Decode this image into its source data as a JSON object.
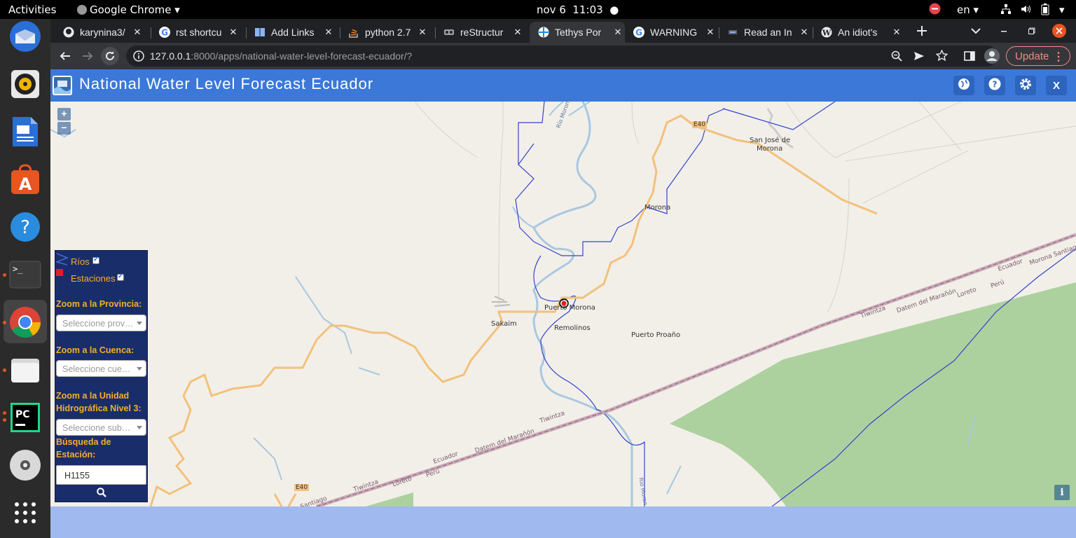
{
  "system_bar": {
    "activities": "Activities",
    "app_name": "Google Chrome",
    "date": "nov 6",
    "time": "11:03",
    "lang": "en"
  },
  "dock": {
    "items": [
      {
        "name": "thunderbird-icon"
      },
      {
        "name": "rhythmbox-icon"
      },
      {
        "name": "libreoffice-writer-icon"
      },
      {
        "name": "ubuntu-software-icon"
      },
      {
        "name": "help-icon"
      },
      {
        "name": "terminal-icon"
      },
      {
        "name": "chrome-icon"
      },
      {
        "name": "files-icon"
      },
      {
        "name": "pycharm-icon"
      },
      {
        "name": "dvd-icon"
      },
      {
        "name": "show-apps-icon"
      }
    ]
  },
  "tabs": [
    {
      "label": "karynina3/",
      "icon": "github-icon"
    },
    {
      "label": "rst shortcu",
      "icon": "google-icon"
    },
    {
      "label": "Add Links",
      "icon": "book-icon"
    },
    {
      "label": "python 2.7",
      "icon": "stackoverflow-icon"
    },
    {
      "label": "reStructur",
      "icon": "doc-icon"
    },
    {
      "label": "Tethys Por",
      "icon": "tethys-icon",
      "active": true
    },
    {
      "label": "WARNING",
      "icon": "google-icon"
    },
    {
      "label": "Read an In",
      "icon": "site-icon"
    },
    {
      "label": "An idiot's",
      "icon": "wordpress-icon"
    }
  ],
  "address_bar": {
    "host": "127.0.0.1",
    "path": ":8000/apps/national-water-level-forecast-ecuador/?",
    "update_label": "Update"
  },
  "app": {
    "title": "National Water Level Forecast Ecuador",
    "close_label": "X",
    "help_label": "?"
  },
  "map": {
    "zoom_in": "+",
    "zoom_out": "−",
    "info": "i",
    "labels": {
      "san_jose": "San José de",
      "san_jose2": "Morona",
      "morona": "Morona",
      "puerto_morona": "Puerto Morona",
      "sakaim": "Sakaim",
      "remolinos": "Remolinos",
      "puerto_proano": "Puerto Proaño",
      "e40_top": "E40",
      "e40_bottom": "E40",
      "ecuador_r": "Ecuador",
      "morona_santiago": "Morona Santiago",
      "twintza_r": "Tiwintza",
      "peru_r": "Perú",
      "loreto_r": "Loreto",
      "datem_r": "Datem del Marañón",
      "twintza_m": "Tiwintza",
      "datem_m": "Datem del Marañón",
      "ecuador_m": "Ecuador",
      "peru_m": "Perú",
      "loreto_m": "Loreto",
      "twintza_l": "Tiwintza",
      "santiago_l": "Santiago",
      "rio_morona_top": "Río Morona",
      "rio_morona_bottom": "Río Moron"
    }
  },
  "panel": {
    "rios": "Ríos",
    "estaciones": "Estaciones",
    "zoom_provincia": "Zoom a la Provincia:",
    "provincia_placeholder": "Seleccione prov…",
    "zoom_cuenca": "Zoom a la Cuenca:",
    "cuenca_placeholder": "Seleccione cue…",
    "zoom_unidad": "Zoom a la Unidad Hidrográfica Nivel 3:",
    "unidad_placeholder": "Seleccione sub…",
    "busqueda": "Búsqueda de Estación:",
    "search_value": "H1155"
  },
  "colors": {
    "header": "#3c78d8",
    "panel": "#1a2d6b",
    "label": "#f5b021",
    "river": "#3344cc",
    "road": "#f3c17a",
    "forest": "#add19e"
  }
}
